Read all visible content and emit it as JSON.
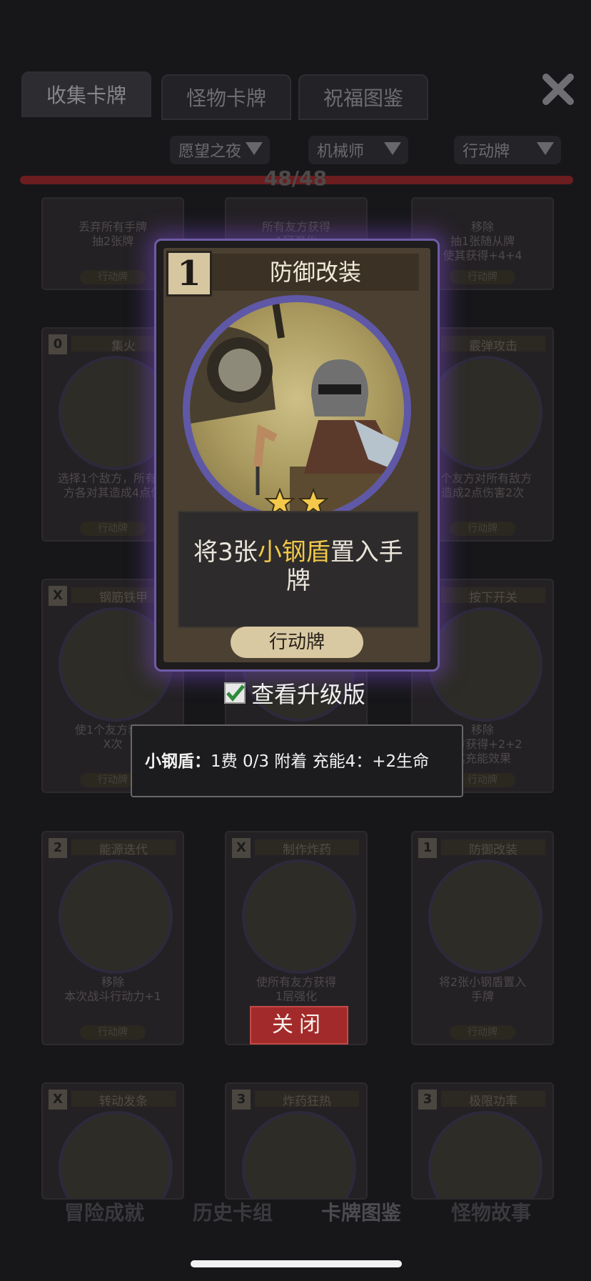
{
  "tabs": [
    {
      "label": "收集卡牌",
      "active": true
    },
    {
      "label": "怪物卡牌",
      "active": false
    },
    {
      "label": "祝福图鉴",
      "active": false
    }
  ],
  "filters": [
    "愿望之夜",
    "机械师",
    "行动牌"
  ],
  "progress": {
    "text": "48/48",
    "value": 1.0
  },
  "background_cards": [
    {
      "cost": "",
      "name": "",
      "desc": "丢弃所有手牌\n抽2张牌",
      "type": "行动牌"
    },
    {
      "cost": "",
      "name": "",
      "desc": "所有友方获得\n1层强化",
      "type": "行动牌"
    },
    {
      "cost": "",
      "name": "",
      "desc": "移除\n抽1张随从牌\n使其获得+4+4",
      "type": "行动牌"
    },
    {
      "cost": "0",
      "name": "集火",
      "desc": "选择1个敌方，所有友\n方各对其造成4点伤",
      "type": "行动牌"
    },
    {
      "cost": "",
      "name": "",
      "desc": "",
      "type": ""
    },
    {
      "cost": "",
      "name": "霰弹攻击",
      "desc": "1个友方对所有敌方\n造成2点伤害2次",
      "type": "行动牌"
    },
    {
      "cost": "X",
      "name": "钢筋铁甲",
      "desc": "使1个友方获得\nX次",
      "type": "行动牌"
    },
    {
      "cost": "",
      "name": "",
      "desc": "",
      "type": ""
    },
    {
      "cost": "",
      "name": "按下开关",
      "desc": "移除\n友方获得+2+2\n其充能效果",
      "type": "行动牌"
    },
    {
      "cost": "2",
      "name": "能源迭代",
      "desc": "移除\n本次战斗行动力+1",
      "type": "行动牌"
    },
    {
      "cost": "X",
      "name": "制作炸药",
      "desc": "使所有友方获得\n1层强化",
      "type": ""
    },
    {
      "cost": "1",
      "name": "防御改装",
      "desc": "将2张小钢盾置入\n手牌",
      "type": "行动牌"
    },
    {
      "cost": "X",
      "name": "转动发条",
      "desc": "",
      "type": ""
    },
    {
      "cost": "3",
      "name": "炸药狂热",
      "desc": "",
      "type": ""
    },
    {
      "cost": "3",
      "name": "极限功率",
      "desc": "",
      "type": ""
    }
  ],
  "modal": {
    "cost": "1",
    "title": "防御改装",
    "desc_pre": "将3张",
    "desc_highlight": "小钢盾",
    "desc_post": "置入手牌",
    "type": "行动牌",
    "stars": 2,
    "upgrade_label": "查看升级版",
    "upgrade_checked": true,
    "tooltip_keyword": "小钢盾：",
    "tooltip_text": "1费 0/3 附着 充能4：+2生命",
    "close_label": "关闭"
  },
  "bottom_nav": [
    {
      "label": "冒险成就",
      "active": false
    },
    {
      "label": "历史卡组",
      "active": false
    },
    {
      "label": "卡牌图鉴",
      "active": true
    },
    {
      "label": "怪物故事",
      "active": false
    }
  ],
  "colors": {
    "accent_purple": "#6e5ca5",
    "highlight_gold": "#f0c84a",
    "close_red": "#a32a2a"
  }
}
